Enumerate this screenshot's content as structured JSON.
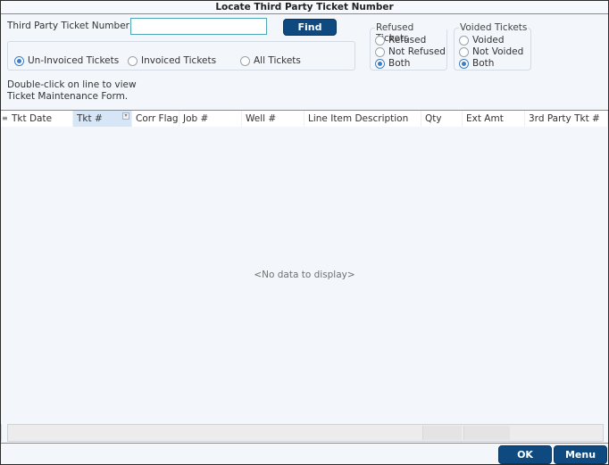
{
  "window": {
    "title": "Locate Third Party Ticket Number"
  },
  "search": {
    "label": "Third Party Ticket Number",
    "value": "",
    "placeholder": "",
    "find_label": "Find"
  },
  "invoice_filter": {
    "options": [
      {
        "label": "Un-Invoiced Tickets",
        "checked": true
      },
      {
        "label": "Invoiced Tickets",
        "checked": false
      },
      {
        "label": "All Tickets",
        "checked": false
      }
    ]
  },
  "hint": {
    "line1": "Double-click on line to view",
    "line2": "Ticket Maintenance Form."
  },
  "refused": {
    "legend": "Refused Tickets",
    "options": [
      {
        "label": "Refused",
        "checked": false
      },
      {
        "label": "Not Refused",
        "checked": false
      },
      {
        "label": "Both",
        "checked": true
      }
    ]
  },
  "voided": {
    "legend": "Voided Tickets",
    "options": [
      {
        "label": "Voided",
        "checked": false
      },
      {
        "label": "Not Voided",
        "checked": false
      },
      {
        "label": "Both",
        "checked": true
      }
    ]
  },
  "grid": {
    "columns": [
      "Tkt Date",
      "Tkt #",
      "Corr Flag",
      "Job #",
      "Well #",
      "Line Item Description",
      "Qty",
      "Ext Amt",
      "3rd Party Tkt #"
    ],
    "sorted_column": "Tkt #",
    "empty_text": "<No data to display>"
  },
  "footer": {
    "ok_label": "OK",
    "menu_label": "Menu"
  }
}
